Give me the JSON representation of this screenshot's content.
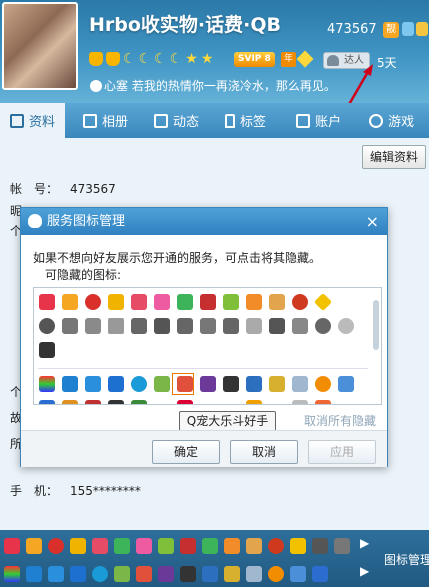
{
  "profile": {
    "nickname": "Hrbo收实物·话费·QB",
    "qq_number": "473567",
    "qq_badge": "靓",
    "svip_label": "SVIP 8",
    "year_label": "年",
    "daren_label": "达人",
    "days": "5天",
    "signature": "心塞 若我的热情你一再浇冷水，那么再见。"
  },
  "tabs": [
    {
      "label": "资料",
      "icon": "profile-icon"
    },
    {
      "label": "相册",
      "icon": "photo-icon"
    },
    {
      "label": "动态",
      "icon": "feed-icon"
    },
    {
      "label": "标签",
      "icon": "tag-icon"
    },
    {
      "label": "账户",
      "icon": "wallet-icon"
    },
    {
      "label": "游戏",
      "icon": "game-icon"
    }
  ],
  "content": {
    "edit_button": "编辑资料",
    "account_label": "帐　号：",
    "account_value": "473567",
    "nick_label": "昵",
    "personal_label": "个",
    "label_ge": "个",
    "label_gu": "故",
    "label_suo": "所",
    "phone_label": "手　机：",
    "phone_value": "155********"
  },
  "dialog": {
    "title": "服务图标管理",
    "instruction": "如果不想向好友展示您开通的服务，可点击将其隐藏。",
    "hideable_label": "可隐藏的图标:",
    "tooltip": "Q宠大乐斗好手",
    "cancel_hide_link": "取消所有隐藏",
    "ok_button": "确定",
    "cancel_button": "取消",
    "apply_button": "应用",
    "close_glyph": "×"
  },
  "bottom": {
    "label": "图标管理"
  },
  "colors": {
    "header_top": "#2b79a8",
    "tab_bar": "#3a87bd",
    "dialog_title": "#2f80c0",
    "accent_orange": "#f08a00"
  }
}
